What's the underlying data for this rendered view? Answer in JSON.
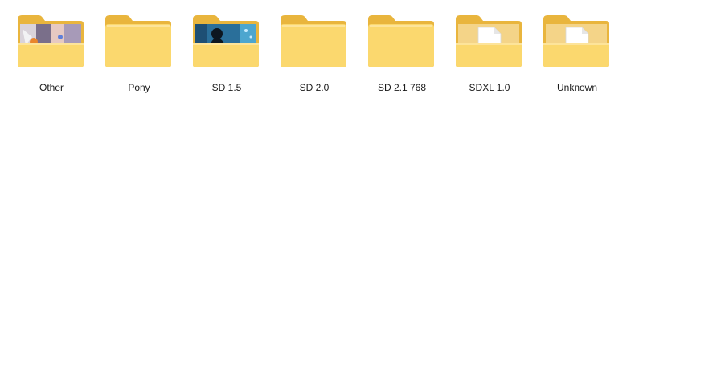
{
  "explorer": {
    "folders": [
      {
        "label": "Other",
        "preview": "anime-artwork-preview",
        "icon": "folder-with-image-icon"
      },
      {
        "label": "Pony",
        "preview": "none",
        "icon": "folder-icon"
      },
      {
        "label": "SD 1.5",
        "preview": "dark-figure-artwork-preview",
        "icon": "folder-with-image-icon"
      },
      {
        "label": "SD 2.0",
        "preview": "none",
        "icon": "folder-icon"
      },
      {
        "label": "SD 2.1 768",
        "preview": "none",
        "icon": "folder-icon"
      },
      {
        "label": "SDXL 1.0",
        "preview": "blank-document",
        "icon": "folder-with-document-icon"
      },
      {
        "label": "Unknown",
        "preview": "blank-document",
        "icon": "folder-with-document-icon"
      }
    ]
  },
  "colors": {
    "folder_back": "#e9b53d",
    "folder_front": "#fbd86e",
    "folder_front_light": "#fde49a",
    "background": "#ffffff"
  }
}
